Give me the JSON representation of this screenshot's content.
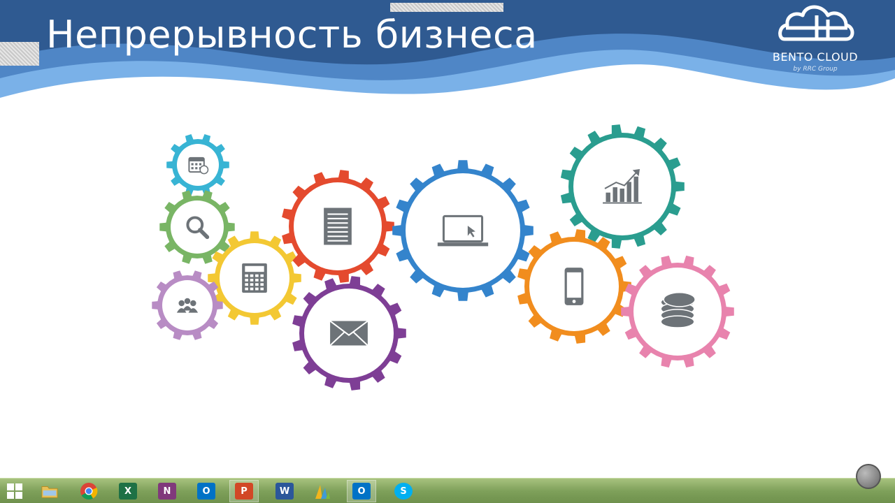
{
  "slide": {
    "title": "Непрерывность бизнеса"
  },
  "logo": {
    "name": "BENTO CLOUD",
    "sub": "by RRC Group"
  },
  "colors": {
    "header_dark": "#2f5a91",
    "header_mid": "#4f86c6",
    "header_light": "#7ab1e8",
    "gear_icon": "#6d7378"
  },
  "gears": [
    {
      "name": "calendar-gear",
      "icon": "calendar-icon",
      "color": "#38b4d4"
    },
    {
      "name": "search-gear",
      "icon": "magnifier-icon",
      "color": "#79b565"
    },
    {
      "name": "calculator-gear",
      "icon": "calculator-icon",
      "color": "#f3c833"
    },
    {
      "name": "team-gear",
      "icon": "people-icon",
      "color": "#b88cc4"
    },
    {
      "name": "document-gear",
      "icon": "document-icon",
      "color": "#e44a2e"
    },
    {
      "name": "mail-gear",
      "icon": "envelope-icon",
      "color": "#7e3e95"
    },
    {
      "name": "laptop-gear",
      "icon": "laptop-icon",
      "color": "#3484cc"
    },
    {
      "name": "growth-chart-gear",
      "icon": "bar-chart-icon",
      "color": "#2a9d8f"
    },
    {
      "name": "phone-gear",
      "icon": "smartphone-icon",
      "color": "#f18d1e"
    },
    {
      "name": "coins-gear",
      "icon": "coins-icon",
      "color": "#e883ad"
    }
  ],
  "taskbar": {
    "items": [
      {
        "name": "start-button",
        "icon": "windows-icon",
        "label": "",
        "color": "#3a7bd5"
      },
      {
        "name": "taskbar-explorer",
        "icon": "folder-icon",
        "label": "",
        "color": "#e8c15a"
      },
      {
        "name": "taskbar-chrome",
        "icon": "chrome-icon",
        "label": "",
        "color": "#db4437"
      },
      {
        "name": "taskbar-excel",
        "icon": "excel-icon",
        "label": "X",
        "color": "#1e7145"
      },
      {
        "name": "taskbar-onenote",
        "icon": "onenote-icon",
        "label": "N",
        "color": "#80397b"
      },
      {
        "name": "taskbar-outlook",
        "icon": "outlook-icon",
        "label": "O",
        "color": "#0072c6"
      },
      {
        "name": "taskbar-powerpoint",
        "icon": "powerpoint-icon",
        "label": "P",
        "color": "#d24726"
      },
      {
        "name": "taskbar-word",
        "icon": "word-icon",
        "label": "W",
        "color": "#2b579a"
      },
      {
        "name": "taskbar-dynamics",
        "icon": "dynamics-icon",
        "label": "",
        "color": "#f2b51c"
      },
      {
        "name": "taskbar-outlook-2",
        "icon": "outlook-icon",
        "label": "O",
        "color": "#0072c6"
      },
      {
        "name": "taskbar-skype",
        "icon": "skype-icon",
        "label": "S",
        "color": "#00aff0"
      }
    ]
  }
}
